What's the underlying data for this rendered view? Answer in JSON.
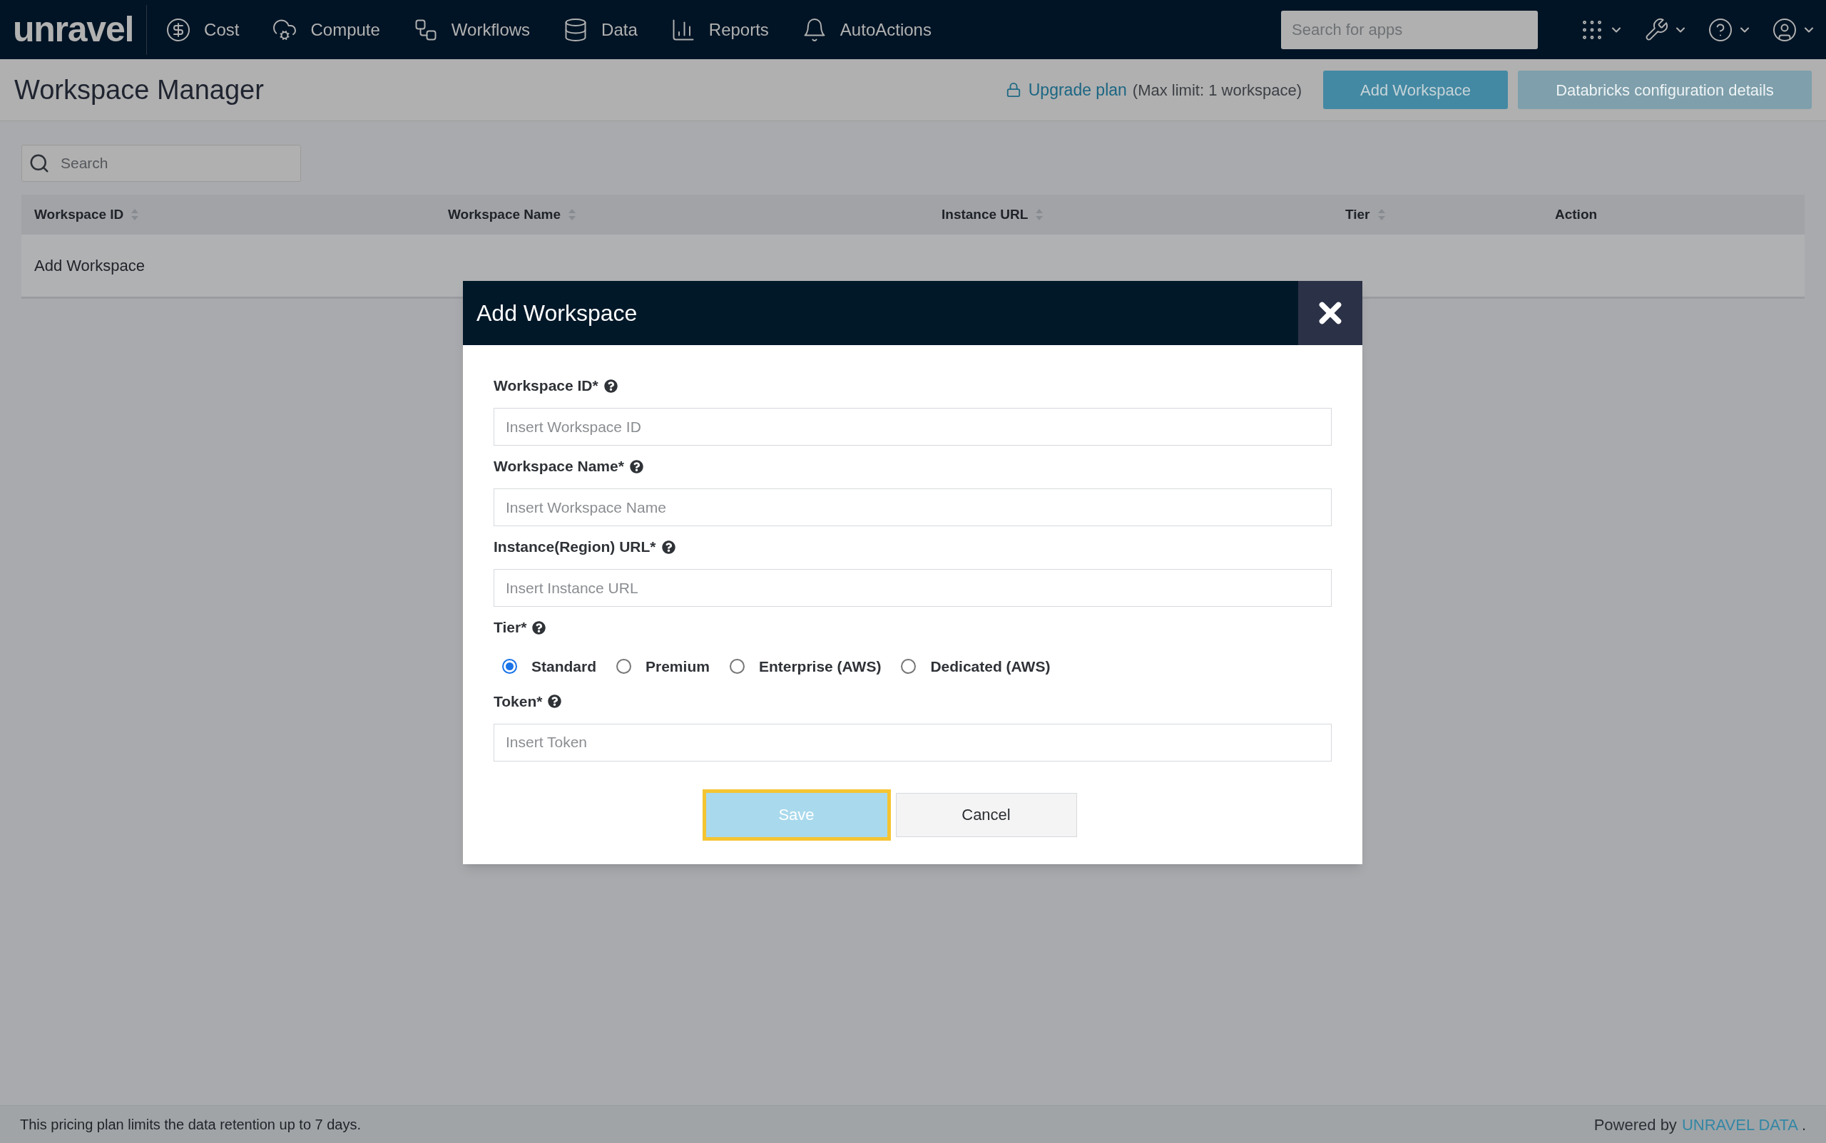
{
  "nav": {
    "logo": "unravel",
    "items": [
      {
        "label": "Cost"
      },
      {
        "label": "Compute"
      },
      {
        "label": "Workflows"
      },
      {
        "label": "Data"
      },
      {
        "label": "Reports"
      },
      {
        "label": "AutoActions"
      }
    ],
    "search": {
      "placeholder": "Search for apps"
    }
  },
  "header": {
    "title": "Workspace Manager",
    "upgrade_link": "Upgrade plan",
    "limit_note": "(Max limit: 1 workspace)",
    "buttons": [
      {
        "label": "Add Workspace",
        "disabled": false
      },
      {
        "label": "Databricks configuration details",
        "disabled": true
      }
    ]
  },
  "table": {
    "search": {
      "placeholder": "Search"
    },
    "columns": [
      {
        "label": "Workspace ID",
        "sortable": true
      },
      {
        "label": "Workspace Name",
        "sortable": true
      },
      {
        "label": "Instance URL",
        "sortable": true
      },
      {
        "label": "Tier",
        "sortable": true
      },
      {
        "label": "Action",
        "sortable": false
      }
    ],
    "rows": [
      [
        "Add Workspace"
      ]
    ]
  },
  "dialog": {
    "title": "Add Workspace",
    "fields": [
      {
        "kind": "text",
        "label": "Workspace ID*",
        "placeholder": "Insert Workspace ID"
      },
      {
        "kind": "text",
        "label": "Workspace Name*",
        "placeholder": "Insert Workspace Name"
      },
      {
        "kind": "text",
        "label": "Instance(Region) URL*",
        "placeholder": "Insert Instance URL"
      },
      {
        "kind": "radio",
        "label": "Tier*",
        "options": [
          {
            "label": "Standard",
            "selected": true
          },
          {
            "label": "Premium",
            "selected": false
          },
          {
            "label": "Enterprise (AWS)",
            "selected": false
          },
          {
            "label": "Dedicated (AWS)",
            "selected": false
          }
        ]
      },
      {
        "kind": "text",
        "label": "Token*",
        "placeholder": "Insert Token"
      }
    ],
    "buttons": [
      {
        "label": "Save",
        "kind": "primary",
        "focused": true
      },
      {
        "label": "Cancel",
        "kind": "secondary",
        "focused": false
      }
    ]
  },
  "footer": {
    "note": "This pricing plan limits the data retention up to 7 days.",
    "powered_by": "Powered by",
    "brand_link": "UNRAVEL DATA",
    "suffix": "."
  }
}
